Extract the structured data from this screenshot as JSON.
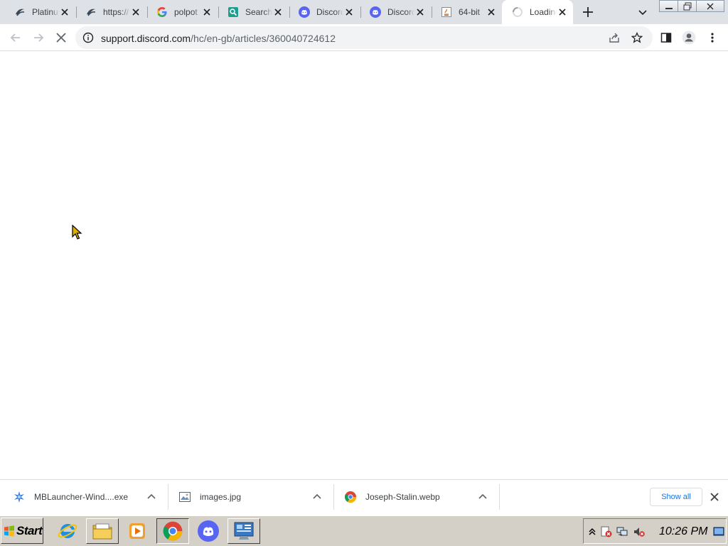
{
  "tabs": [
    {
      "title": "Platinum",
      "icon": "platinum-favicon"
    },
    {
      "title": "https://",
      "icon": "platinum-favicon"
    },
    {
      "title": "polpot",
      "icon": "google-favicon"
    },
    {
      "title": "Search",
      "icon": "search-favicon"
    },
    {
      "title": "Discord",
      "icon": "discord-favicon"
    },
    {
      "title": "Discord",
      "icon": "discord-favicon"
    },
    {
      "title": "64-bit",
      "icon": "java-favicon"
    },
    {
      "title": "Loading",
      "icon": "loading-spinner-icon",
      "active": true
    }
  ],
  "toolbar": {
    "url_host": "support.discord.com",
    "url_path": "/hc/en-gb/articles/360040724612"
  },
  "downloads": {
    "items": [
      {
        "name": "MBLauncher-Wind....exe",
        "icon": "launcher-file-icon"
      },
      {
        "name": "images.jpg",
        "icon": "image-file-icon"
      },
      {
        "name": "Joseph-Stalin.webp",
        "icon": "chrome-file-icon"
      }
    ],
    "show_all_label": "Show all"
  },
  "taskbar": {
    "start_label": "Start",
    "clock": "10:26 PM",
    "pinned": [
      "internet-explorer-icon",
      "file-explorer-icon",
      "media-player-icon",
      "chrome-icon",
      "discord-icon",
      "control-panel-icon"
    ],
    "active": "chrome-icon"
  },
  "colors": {
    "tab_strip": "#dee1e6",
    "discord": "#5865f2",
    "taskbar": "#d4d0c8",
    "link_blue": "#1a73e8"
  }
}
